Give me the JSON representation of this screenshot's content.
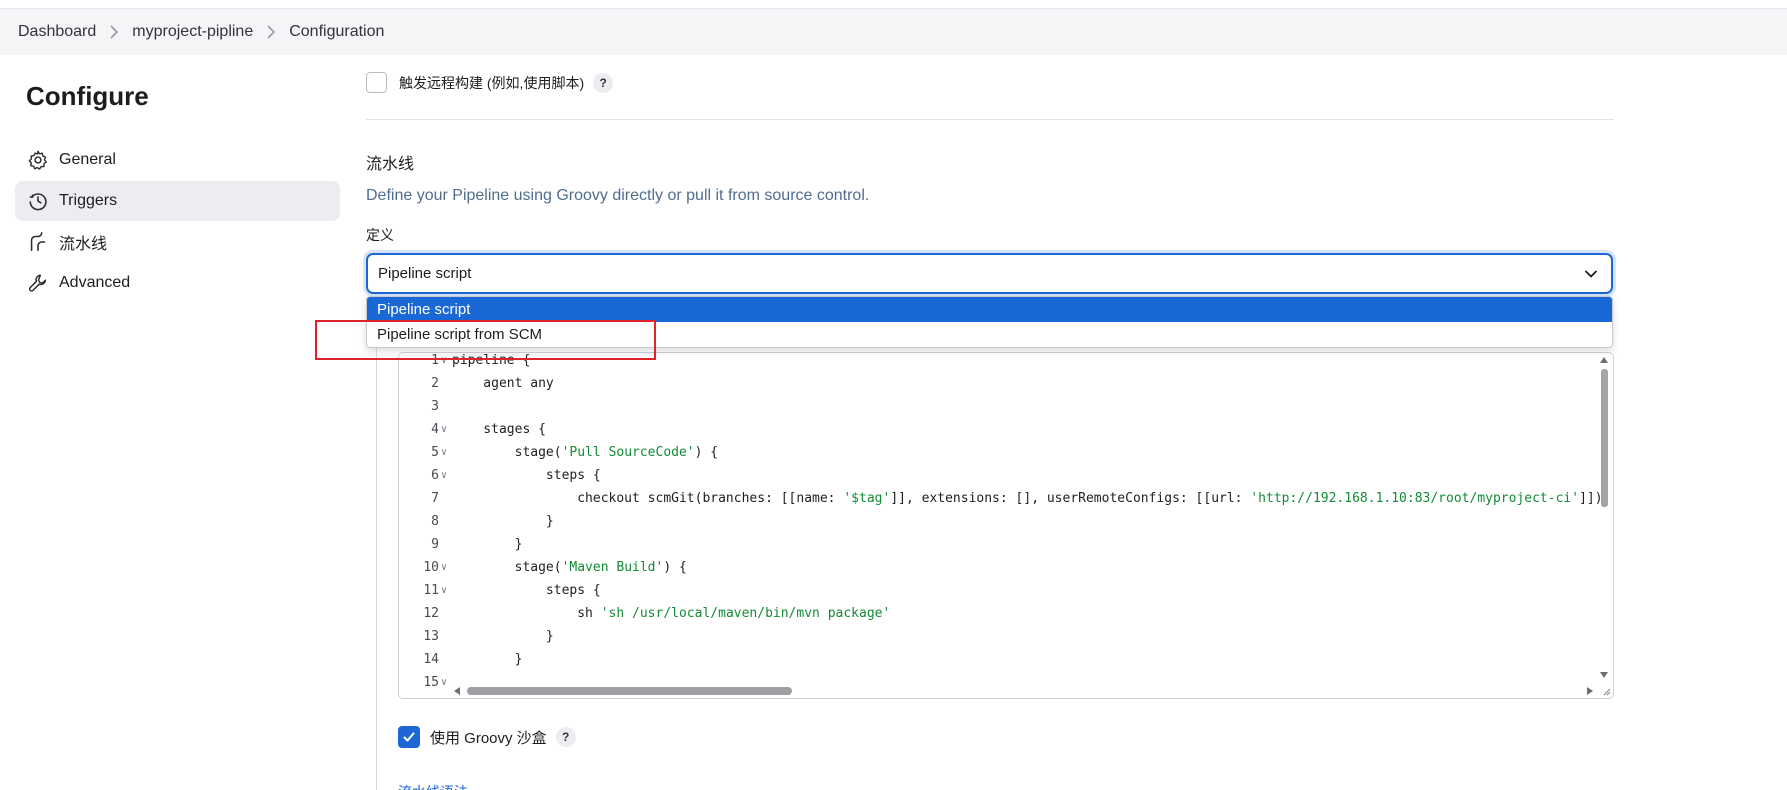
{
  "breadcrumb": {
    "items": [
      "Dashboard",
      "myproject-pipline",
      "Configuration"
    ]
  },
  "sidebar": {
    "title": "Configure",
    "items": [
      {
        "label": "General",
        "icon": "gear-icon"
      },
      {
        "label": "Triggers",
        "icon": "clock-icon",
        "active": true
      },
      {
        "label": "流水线",
        "icon": "pipeline-icon"
      },
      {
        "label": "Advanced",
        "icon": "wrench-icon"
      }
    ]
  },
  "triggers": {
    "remote_build_label": "触发远程构建 (例如,使用脚本)",
    "help": "?"
  },
  "pipeline": {
    "section_title": "流水线",
    "description": "Define your Pipeline using Groovy directly or pull it from source control.",
    "definition_label": "定义",
    "definition_value": "Pipeline script",
    "options": [
      "Pipeline script",
      "Pipeline script from SCM"
    ],
    "script_lines": [
      {
        "n": "1",
        "fold": true,
        "parts": [
          [
            "pipeline {",
            "k"
          ]
        ]
      },
      {
        "n": "2",
        "fold": false,
        "parts": [
          [
            "    agent any",
            "k"
          ]
        ]
      },
      {
        "n": "3",
        "fold": false,
        "parts": [
          [
            "",
            "k"
          ]
        ]
      },
      {
        "n": "4",
        "fold": true,
        "parts": [
          [
            "    stages {",
            "k"
          ]
        ]
      },
      {
        "n": "5",
        "fold": true,
        "parts": [
          [
            "        stage(",
            "k"
          ],
          [
            "'Pull SourceCode'",
            "s"
          ],
          [
            ") {",
            "k"
          ]
        ]
      },
      {
        "n": "6",
        "fold": true,
        "parts": [
          [
            "            steps {",
            "k"
          ]
        ]
      },
      {
        "n": "7",
        "fold": false,
        "parts": [
          [
            "                checkout scmGit(branches: [[name: ",
            "k"
          ],
          [
            "'$tag'",
            "s"
          ],
          [
            "]], extensions: [], userRemoteConfigs: [[url: ",
            "k"
          ],
          [
            "'http://192.168.1.10:83/root/myproject-ci'",
            "s"
          ],
          [
            "]])",
            "k"
          ]
        ]
      },
      {
        "n": "8",
        "fold": false,
        "parts": [
          [
            "            }",
            "k"
          ]
        ]
      },
      {
        "n": "9",
        "fold": false,
        "parts": [
          [
            "        }",
            "k"
          ]
        ]
      },
      {
        "n": "10",
        "fold": true,
        "parts": [
          [
            "        stage(",
            "k"
          ],
          [
            "'Maven Build'",
            "s"
          ],
          [
            ") {",
            "k"
          ]
        ]
      },
      {
        "n": "11",
        "fold": true,
        "parts": [
          [
            "            steps {",
            "k"
          ]
        ]
      },
      {
        "n": "12",
        "fold": false,
        "parts": [
          [
            "                sh ",
            "k"
          ],
          [
            "'sh /usr/local/maven/bin/mvn package'",
            "s"
          ]
        ]
      },
      {
        "n": "13",
        "fold": false,
        "parts": [
          [
            "            }",
            "k"
          ]
        ]
      },
      {
        "n": "14",
        "fold": false,
        "parts": [
          [
            "        }",
            "k"
          ]
        ]
      },
      {
        "n": "15",
        "fold": true,
        "parts": [
          [
            "",
            "k"
          ]
        ]
      }
    ],
    "groovy_sandbox_label": "使用 Groovy 沙盒",
    "groovy_sandbox_checked": true,
    "bottom_link": "流水线语法"
  },
  "colors": {
    "accent": "#1d67d4",
    "selected_option": "#1a68d6",
    "highlight_box": "#e0222a",
    "string": "#138a36"
  }
}
